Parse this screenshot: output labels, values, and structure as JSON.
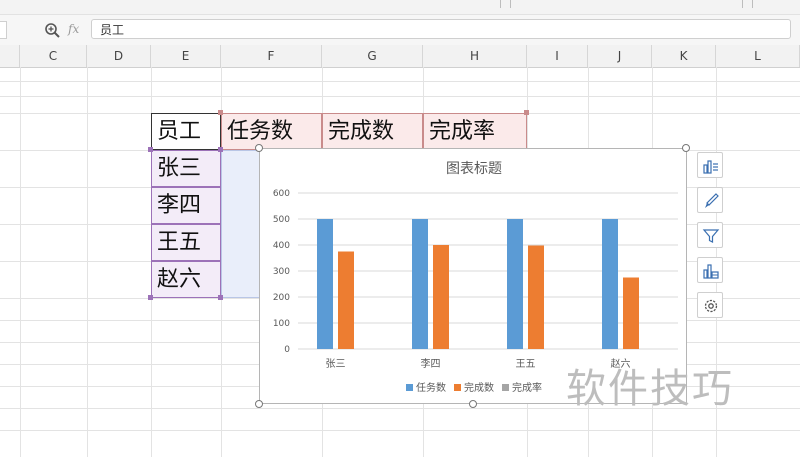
{
  "formula_bar": {
    "fx_label": "fx",
    "cell_value": "员工"
  },
  "columns": [
    "C",
    "D",
    "E",
    "F",
    "G",
    "H",
    "I",
    "J",
    "K",
    "L"
  ],
  "table": {
    "headers": [
      "员工",
      "任务数",
      "完成数",
      "完成率"
    ],
    "rows": [
      "张三",
      "李四",
      "王五",
      "赵六"
    ]
  },
  "chart_data": {
    "type": "bar",
    "title": "图表标题",
    "categories": [
      "张三",
      "李四",
      "王五",
      "赵六"
    ],
    "series": [
      {
        "name": "任务数",
        "values": [
          500,
          500,
          500,
          500
        ],
        "color": "#5b9bd5"
      },
      {
        "name": "完成数",
        "values": [
          375,
          400,
          398,
          275
        ],
        "color": "#ed7d31"
      },
      {
        "name": "完成率",
        "values": [
          0,
          0,
          0,
          0
        ],
        "color": "#a5a5a5"
      }
    ],
    "ylim": [
      0,
      600
    ],
    "yticks": [
      "0",
      "100",
      "200",
      "300",
      "400",
      "500",
      "600"
    ],
    "grid": true,
    "legend": "bottom"
  },
  "side_tools": [
    "chart-elements-icon",
    "chart-style-icon",
    "chart-filter-icon",
    "chart-data-icon",
    "chart-settings-icon"
  ],
  "watermark": "软件技巧"
}
